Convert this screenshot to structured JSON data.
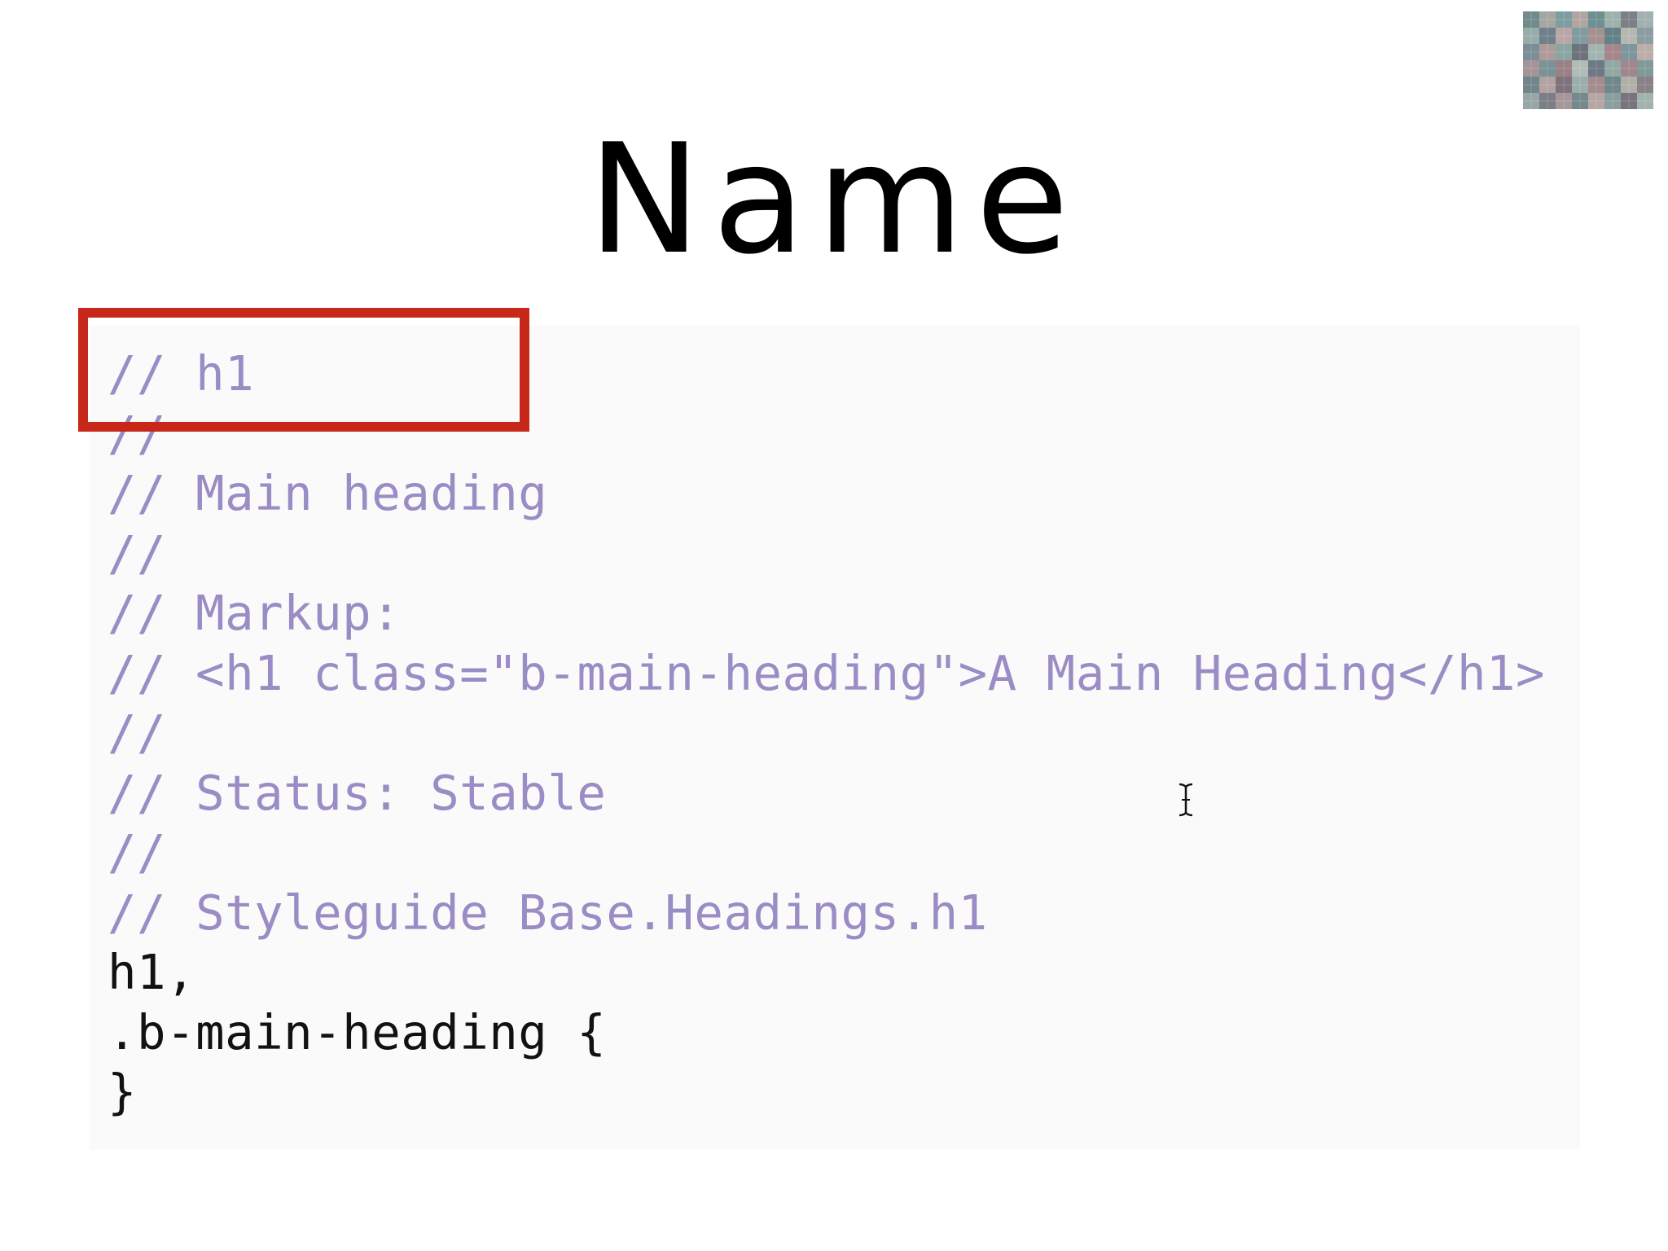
{
  "slide": {
    "title": "Name"
  },
  "code_block": {
    "lines": [
      {
        "text": "// h1",
        "kind": "comment"
      },
      {
        "text": "//",
        "kind": "comment"
      },
      {
        "text": "// Main heading",
        "kind": "comment"
      },
      {
        "text": "//",
        "kind": "comment"
      },
      {
        "text": "// Markup:",
        "kind": "comment"
      },
      {
        "text": "// <h1 class=\"b-main-heading\">A Main Heading</h1>",
        "kind": "comment"
      },
      {
        "text": "//",
        "kind": "comment"
      },
      {
        "text": "// Status: Stable",
        "kind": "comment"
      },
      {
        "text": "//",
        "kind": "comment"
      },
      {
        "text": "// Styleguide Base.Headings.h1",
        "kind": "comment"
      },
      {
        "text": "h1,",
        "kind": "code"
      },
      {
        "text": ".b-main-heading {",
        "kind": "code"
      },
      {
        "text": "}",
        "kind": "code"
      }
    ]
  },
  "colors": {
    "comment": "#9a8cc4",
    "code": "#111111",
    "highlight": "#c8281a",
    "panel_background": "#fafafa"
  },
  "icons": {
    "cursor": "text-cursor-icon",
    "thumbnail": "presenter-thumbnail"
  }
}
